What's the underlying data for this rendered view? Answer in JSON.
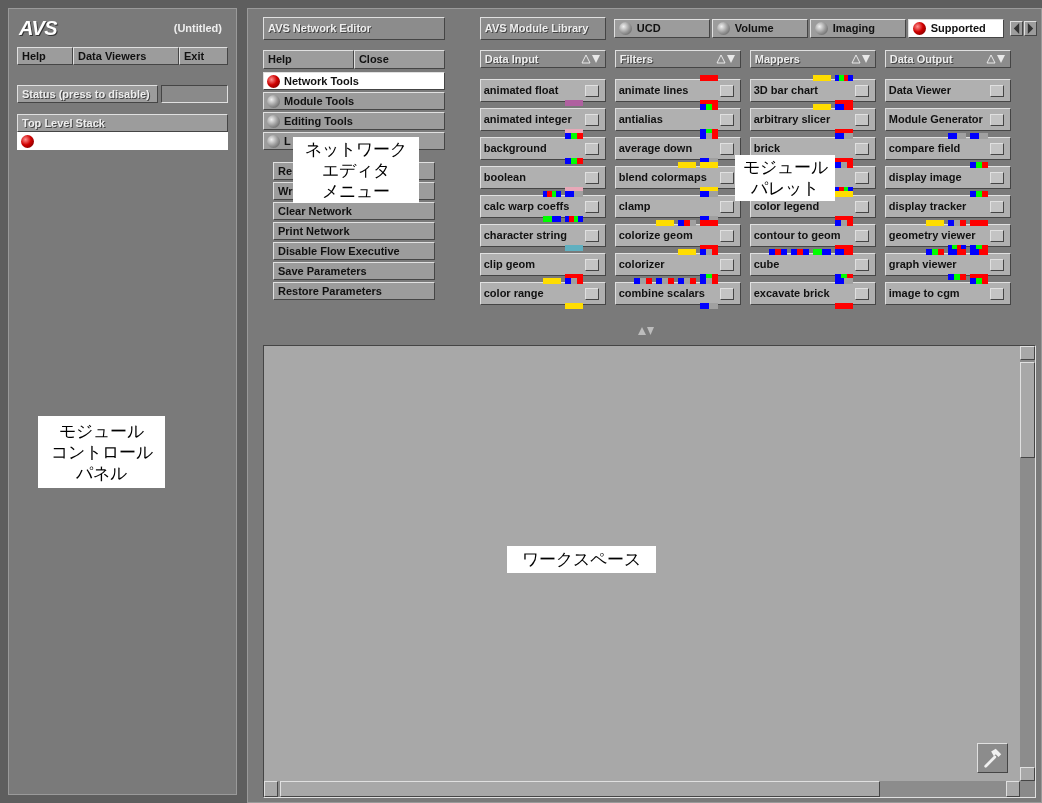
{
  "control_panel": {
    "logo": "AVS",
    "title": "(Untitled)",
    "menu": [
      "Help",
      "Data Viewers",
      "Exit"
    ],
    "status_button": "Status (press to disable)",
    "stack": {
      "header": "Top Level Stack",
      "items": [
        {
          "selected": true
        }
      ]
    }
  },
  "network_editor": {
    "title": "AVS Network Editor",
    "menu": [
      "Help",
      "Close"
    ],
    "tools": [
      {
        "label": "Network Tools",
        "selected": true
      },
      {
        "label": "Module Tools",
        "selected": false
      },
      {
        "label": "Editing Tools",
        "selected": false
      },
      {
        "label": "L",
        "selected": false
      }
    ],
    "actions": [
      "Re",
      "Wr",
      "Clear Network",
      "Print Network",
      "Disable Flow Executive",
      "Save Parameters",
      "Restore Parameters"
    ]
  },
  "module_library": {
    "title": "AVS Module Library",
    "tabs": [
      {
        "label": "UCD",
        "selected": false
      },
      {
        "label": "Volume",
        "selected": false
      },
      {
        "label": "Imaging",
        "selected": false
      },
      {
        "label": "Supported",
        "selected": true
      }
    ],
    "columns": [
      {
        "header": "Data Input",
        "modules": [
          {
            "label": "animated float",
            "out": [
              [
                {
                  "color": "#b060a0"
                }
              ]
            ]
          },
          {
            "label": "animated integer",
            "out": [
              [
                {
                  "color": "#e8a8b8"
                }
              ]
            ]
          },
          {
            "label": "background",
            "in": [
              [
                {
                  "color": "#0000ff"
                },
                {
                  "color": "#00ff00"
                },
                {
                  "color": "#ff0000"
                }
              ]
            ],
            "out": [
              [
                {
                  "color": "#0000ff"
                },
                {
                  "color": "#00ff00"
                },
                {
                  "color": "#ff0000"
                }
              ]
            ]
          },
          {
            "label": "boolean",
            "out": [
              [
                {
                  "color": "#e8a8b8"
                }
              ]
            ]
          },
          {
            "label": "calc warp coeffs",
            "in": [
              [
                {
                  "color": "#0000ff"
                },
                {
                  "color": "#ff0000"
                },
                {
                  "color": "#00ff00"
                },
                {
                  "color": "#0000ff"
                }
              ],
              [
                {
                  "color": "#0000ff"
                },
                {
                  "color": "#a0a0a0"
                }
              ]
            ],
            "out": [
              [
                {
                  "color": "#00ff00"
                },
                {
                  "color": "#0000ff"
                }
              ],
              [
                {
                  "color": "#0000ff"
                },
                {
                  "color": "#ff0000"
                },
                {
                  "color": "#00ff00"
                },
                {
                  "color": "#0000ff"
                }
              ]
            ]
          },
          {
            "label": "character string",
            "out": [
              [
                {
                  "color": "#60b0c0"
                }
              ]
            ]
          },
          {
            "label": "clip geom",
            "out": [
              [
                {
                  "color": "#ff0000"
                }
              ]
            ]
          },
          {
            "label": "color range",
            "in": [
              [
                {
                  "color": "#ffdd00"
                }
              ],
              [
                {
                  "color": "#0000ff"
                },
                {
                  "color": "#a0a0a0"
                },
                {
                  "color": "#ff0000"
                }
              ]
            ],
            "out": [
              [
                {
                  "color": "#ffdd00"
                }
              ]
            ]
          }
        ]
      },
      {
        "header": "Filters",
        "modules": [
          {
            "label": "animate lines",
            "in": [
              [
                {
                  "color": "#ff0000"
                }
              ]
            ],
            "out": [
              [
                {
                  "color": "#ff0000"
                }
              ]
            ]
          },
          {
            "label": "antialias",
            "in": [
              [
                {
                  "color": "#0000ff"
                },
                {
                  "color": "#00ff00"
                },
                {
                  "color": "#ff0000"
                }
              ]
            ],
            "out": [
              [
                {
                  "color": "#0000ff"
                },
                {
                  "color": "#00ff00"
                },
                {
                  "color": "#ff0000"
                }
              ]
            ]
          },
          {
            "label": "average down",
            "in": [
              [
                {
                  "color": "#0000ff"
                },
                {
                  "color": "#a0a0a0"
                },
                {
                  "color": "#ff0000"
                }
              ]
            ],
            "out": [
              [
                {
                  "color": "#0000ff"
                },
                {
                  "color": "#a0a0a0"
                }
              ]
            ]
          },
          {
            "label": "blend colormaps",
            "in": [
              [
                {
                  "color": "#ffdd00"
                }
              ],
              [
                {
                  "color": "#ffdd00"
                }
              ]
            ],
            "out": [
              [
                {
                  "color": "#ffdd00"
                }
              ]
            ]
          },
          {
            "label": "clamp",
            "in": [
              [
                {
                  "color": "#0000ff"
                },
                {
                  "color": "#a0a0a0"
                }
              ]
            ],
            "out": [
              [
                {
                  "color": "#0000ff"
                },
                {
                  "color": "#a0a0a0"
                }
              ]
            ]
          },
          {
            "label": "colorize geom",
            "in": [
              [
                {
                  "color": "#ffdd00"
                }
              ],
              [
                {
                  "color": "#0000ff"
                },
                {
                  "color": "#ff0000"
                },
                {
                  "color": "#a0a0a0"
                }
              ],
              [
                {
                  "color": "#ff0000"
                }
              ]
            ],
            "out": [
              [
                {
                  "color": "#ff0000"
                }
              ]
            ]
          },
          {
            "label": "colorizer",
            "in": [
              [
                {
                  "color": "#ffdd00"
                }
              ],
              [
                {
                  "color": "#0000ff"
                },
                {
                  "color": "#a0a0a0"
                },
                {
                  "color": "#ff0000"
                }
              ]
            ],
            "out": [
              [
                {
                  "color": "#0000ff"
                },
                {
                  "color": "#00ff00"
                },
                {
                  "color": "#ff0000"
                }
              ]
            ]
          },
          {
            "label": "combine scalars",
            "in": [
              [
                {
                  "color": "#0000ff"
                },
                {
                  "color": "#a0a0a0"
                },
                {
                  "color": "#ff0000"
                }
              ],
              [
                {
                  "color": "#0000ff"
                },
                {
                  "color": "#a0a0a0"
                },
                {
                  "color": "#ff0000"
                }
              ],
              [
                {
                  "color": "#0000ff"
                },
                {
                  "color": "#a0a0a0"
                },
                {
                  "color": "#ff0000"
                }
              ],
              [
                {
                  "color": "#0000ff"
                },
                {
                  "color": "#a0a0a0"
                },
                {
                  "color": "#ff0000"
                }
              ]
            ],
            "out": [
              [
                {
                  "color": "#0000ff"
                },
                {
                  "color": "#a0a0a0"
                }
              ]
            ]
          }
        ]
      },
      {
        "header": "Mappers",
        "modules": [
          {
            "label": "3D bar chart",
            "in": [
              [
                {
                  "color": "#ffdd00"
                }
              ],
              [
                {
                  "color": "#0000ff"
                },
                {
                  "color": "#00ff00"
                },
                {
                  "color": "#ff0000"
                },
                {
                  "color": "#0000ff"
                }
              ]
            ],
            "out": [
              [
                {
                  "color": "#ff0000"
                }
              ]
            ]
          },
          {
            "label": "arbitrary slicer",
            "in": [
              [
                {
                  "color": "#ffdd00"
                }
              ],
              [
                {
                  "color": "#0000ff"
                },
                {
                  "color": "#ff0000"
                }
              ]
            ],
            "out": [
              [
                {
                  "color": "#ff0000"
                }
              ]
            ]
          },
          {
            "label": "brick",
            "in": [
              [
                {
                  "color": "#0000ff"
                },
                {
                  "color": "#a0a0a0"
                }
              ]
            ],
            "out": [
              [
                {
                  "color": "#ff0000"
                }
              ]
            ]
          },
          {
            "in": [
              [
                {
                  "color": "#0000ff"
                },
                {
                  "color": "#a0a0a0"
                },
                {
                  "color": "#ff0000"
                }
              ]
            ],
            "out": [
              [
                {
                  "color": "#0000ff"
                },
                {
                  "color": "#ff0000"
                },
                {
                  "color": "#00ff00"
                },
                {
                  "color": "#0000ff"
                }
              ]
            ]
          },
          {
            "label": "color legend",
            "in": [
              [
                {
                  "color": "#ffdd00"
                }
              ]
            ],
            "out": [
              [
                {
                  "color": "#ff0000"
                }
              ]
            ]
          },
          {
            "label": "contour to geom",
            "in": [
              [
                {
                  "color": "#0000ff"
                },
                {
                  "color": "#a0a0a0"
                },
                {
                  "color": "#ff0000"
                }
              ]
            ],
            "out": [
              [
                {
                  "color": "#ff0000"
                }
              ]
            ]
          },
          {
            "label": "cube",
            "in": [
              [
                {
                  "color": "#0000ff"
                },
                {
                  "color": "#ff0000"
                },
                {
                  "color": "#0000ff"
                }
              ],
              [
                {
                  "color": "#0000ff"
                },
                {
                  "color": "#ff0000"
                },
                {
                  "color": "#0000ff"
                }
              ],
              [
                {
                  "color": "#00ff00"
                },
                {
                  "color": "#0000ff"
                }
              ],
              [
                {
                  "color": "#0000ff"
                },
                {
                  "color": "#ff0000"
                }
              ]
            ],
            "out": [
              [
                {
                  "color": "#0000ff"
                },
                {
                  "color": "#00ff00"
                },
                {
                  "color": "#ff0000"
                }
              ]
            ]
          },
          {
            "label": "excavate brick",
            "in": [
              [
                {
                  "color": "#0000ff"
                },
                {
                  "color": "#a0a0a0"
                }
              ]
            ],
            "out": [
              [
                {
                  "color": "#ff0000"
                }
              ]
            ]
          }
        ]
      },
      {
        "header": "Data Output",
        "modules": [
          {
            "label": "Data Viewer"
          },
          {
            "label": "Module Generator"
          },
          {
            "label": "compare field",
            "in": [
              [
                {
                  "color": "#0000ff"
                },
                {
                  "color": "#a0a0a0"
                }
              ],
              [
                {
                  "color": "#0000ff"
                },
                {
                  "color": "#a0a0a0"
                }
              ]
            ]
          },
          {
            "label": "display image",
            "in": [
              [
                {
                  "color": "#0000ff"
                },
                {
                  "color": "#00ff00"
                },
                {
                  "color": "#ff0000"
                }
              ]
            ]
          },
          {
            "label": "display tracker",
            "in": [
              [
                {
                  "color": "#0000ff"
                },
                {
                  "color": "#00ff00"
                },
                {
                  "color": "#ff0000"
                }
              ]
            ]
          },
          {
            "label": "geometry viewer",
            "in": [
              [
                {
                  "color": "#ffdd00"
                }
              ],
              [
                {
                  "color": "#0000ff"
                },
                {
                  "color": "#a0a0a0"
                },
                {
                  "color": "#ff0000"
                }
              ],
              [
                {
                  "color": "#ff0000"
                }
              ]
            ],
            "out": [
              [
                {
                  "color": "#0000ff"
                },
                {
                  "color": "#00ff00"
                },
                {
                  "color": "#ff0000"
                },
                {
                  "color": "#0000ff"
                }
              ],
              [
                {
                  "color": "#0000ff"
                },
                {
                  "color": "#00ff00"
                },
                {
                  "color": "#ff0000"
                }
              ]
            ]
          },
          {
            "label": "graph viewer",
            "in": [
              [
                {
                  "color": "#0000ff"
                },
                {
                  "color": "#00ff00"
                },
                {
                  "color": "#ff0000"
                }
              ],
              [
                {
                  "color": "#0000ff"
                },
                {
                  "color": "#ff0000"
                }
              ],
              [
                {
                  "color": "#0000ff"
                },
                {
                  "color": "#ff0000"
                }
              ]
            ],
            "out": [
              [
                {
                  "color": "#0000ff"
                },
                {
                  "color": "#00ff00"
                },
                {
                  "color": "#ff0000"
                }
              ],
              [
                {
                  "color": "#ff0000"
                }
              ]
            ]
          },
          {
            "label": "image to cgm",
            "in": [
              [
                {
                  "color": "#0000ff"
                },
                {
                  "color": "#00ff00"
                },
                {
                  "color": "#ff0000"
                }
              ]
            ]
          }
        ]
      }
    ]
  },
  "callouts": [
    {
      "lines": [
        "モジュール",
        "コントロール",
        "パネル"
      ]
    },
    {
      "lines": [
        "ネットワーク",
        "エディタ",
        "メニュー"
      ]
    },
    {
      "lines": [
        "モジュール",
        "パレット"
      ]
    },
    {
      "lines": [
        "ワークスペース"
      ]
    }
  ]
}
